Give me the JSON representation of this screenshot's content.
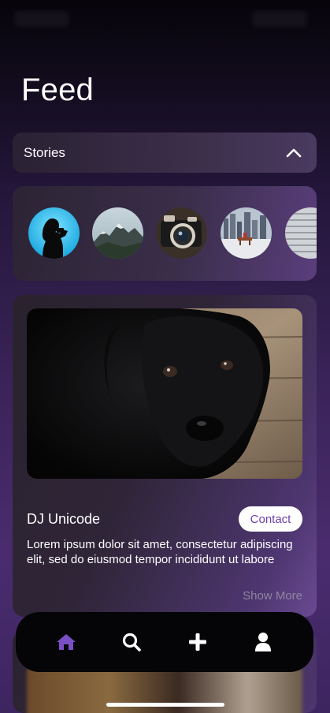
{
  "header": {
    "title": "Feed"
  },
  "stories": {
    "label": "Stories",
    "toggle_icon": "chevron-up-icon",
    "items": [
      {
        "name": "story-photographer",
        "icon": "photographer-silhouette"
      },
      {
        "name": "story-mountain",
        "icon": "mountain"
      },
      {
        "name": "story-camera",
        "icon": "camera"
      },
      {
        "name": "story-city-bench",
        "icon": "city-bench"
      },
      {
        "name": "story-partial",
        "icon": "building"
      }
    ]
  },
  "post": {
    "image": "black-dog",
    "author": "DJ Unicode",
    "contact_label": "Contact",
    "body": "Lorem ipsum dolor sit amet, consectetur adipiscing elit, sed do eiusmod tempor incididunt ut labore",
    "show_more_label": "Show More"
  },
  "tab_bar": {
    "items": [
      {
        "name": "home",
        "icon": "home-icon",
        "active": true
      },
      {
        "name": "search",
        "icon": "search-icon",
        "active": false
      },
      {
        "name": "add",
        "icon": "plus-icon",
        "active": false
      },
      {
        "name": "profile",
        "icon": "user-icon",
        "active": false
      }
    ]
  },
  "colors": {
    "accent": "#7a4fc4",
    "contact_text": "#6d3fb0",
    "muted_text": "#8f86a0",
    "tab_bar": "#050407"
  }
}
